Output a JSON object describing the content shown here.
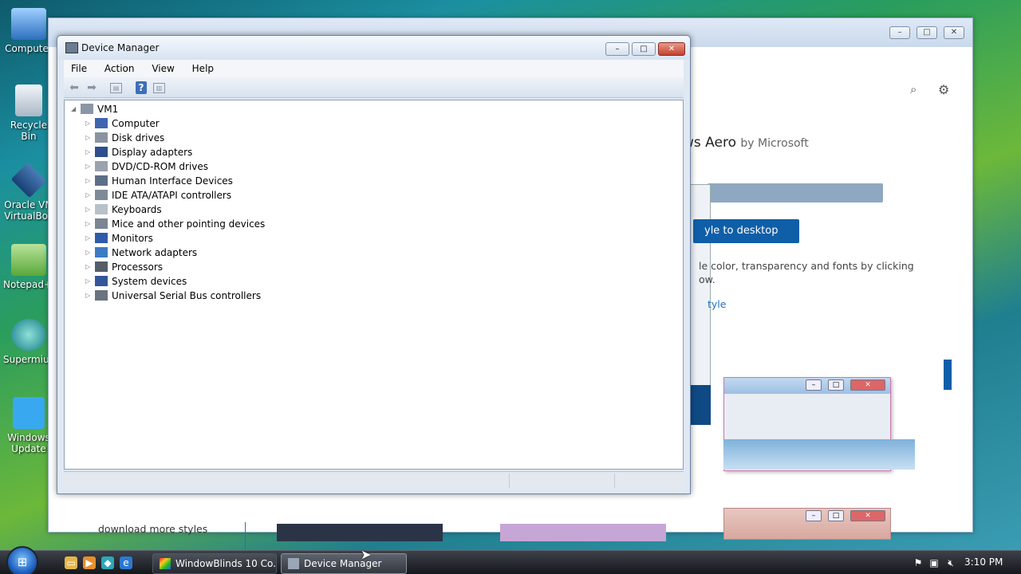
{
  "desktop": {
    "icons": [
      {
        "label": "Computer"
      },
      {
        "label": "Recycle Bin"
      },
      {
        "label": "Oracle VM VirtualBox"
      },
      {
        "label": "Notepad++"
      },
      {
        "label": "Supermium"
      },
      {
        "label": "Windows Update"
      }
    ]
  },
  "background_window": {
    "style_name": "ws Aero",
    "style_by": "by Microsoft",
    "apply_button": "yle to desktop",
    "description": "le color, transparency and fonts by clicking ow.",
    "style_link": "tyle",
    "download_link": "download more styles"
  },
  "device_manager": {
    "title": "Device Manager",
    "menu": [
      "File",
      "Action",
      "View",
      "Help"
    ],
    "tree_root": "VM1",
    "tree_items": [
      {
        "label": "Computer",
        "icon": "computer-icon"
      },
      {
        "label": "Disk drives",
        "icon": "disk-drive-icon"
      },
      {
        "label": "Display adapters",
        "icon": "display-adapter-icon"
      },
      {
        "label": "DVD/CD-ROM drives",
        "icon": "dvd-drive-icon"
      },
      {
        "label": "Human Interface Devices",
        "icon": "hid-icon"
      },
      {
        "label": "IDE ATA/ATAPI controllers",
        "icon": "ide-controller-icon"
      },
      {
        "label": "Keyboards",
        "icon": "keyboard-icon"
      },
      {
        "label": "Mice and other pointing devices",
        "icon": "mouse-icon"
      },
      {
        "label": "Monitors",
        "icon": "monitor-icon"
      },
      {
        "label": "Network adapters",
        "icon": "network-adapter-icon"
      },
      {
        "label": "Processors",
        "icon": "processor-icon"
      },
      {
        "label": "System devices",
        "icon": "system-devices-icon"
      },
      {
        "label": "Universal Serial Bus controllers",
        "icon": "usb-icon"
      }
    ]
  },
  "taskbar": {
    "buttons": [
      {
        "label": "WindowBlinds 10 Co..."
      },
      {
        "label": "Device Manager"
      }
    ],
    "clock": "3:10 PM"
  }
}
